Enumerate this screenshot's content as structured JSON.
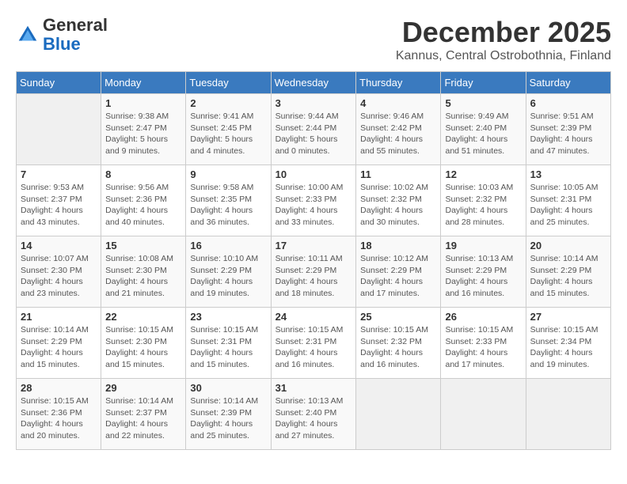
{
  "header": {
    "logo_line1": "General",
    "logo_line2": "Blue",
    "month": "December 2025",
    "location": "Kannus, Central Ostrobothnia, Finland"
  },
  "days_of_week": [
    "Sunday",
    "Monday",
    "Tuesday",
    "Wednesday",
    "Thursday",
    "Friday",
    "Saturday"
  ],
  "weeks": [
    [
      {
        "day": "",
        "info": ""
      },
      {
        "day": "1",
        "info": "Sunrise: 9:38 AM\nSunset: 2:47 PM\nDaylight: 5 hours\nand 9 minutes."
      },
      {
        "day": "2",
        "info": "Sunrise: 9:41 AM\nSunset: 2:45 PM\nDaylight: 5 hours\nand 4 minutes."
      },
      {
        "day": "3",
        "info": "Sunrise: 9:44 AM\nSunset: 2:44 PM\nDaylight: 5 hours\nand 0 minutes."
      },
      {
        "day": "4",
        "info": "Sunrise: 9:46 AM\nSunset: 2:42 PM\nDaylight: 4 hours\nand 55 minutes."
      },
      {
        "day": "5",
        "info": "Sunrise: 9:49 AM\nSunset: 2:40 PM\nDaylight: 4 hours\nand 51 minutes."
      },
      {
        "day": "6",
        "info": "Sunrise: 9:51 AM\nSunset: 2:39 PM\nDaylight: 4 hours\nand 47 minutes."
      }
    ],
    [
      {
        "day": "7",
        "info": "Sunrise: 9:53 AM\nSunset: 2:37 PM\nDaylight: 4 hours\nand 43 minutes."
      },
      {
        "day": "8",
        "info": "Sunrise: 9:56 AM\nSunset: 2:36 PM\nDaylight: 4 hours\nand 40 minutes."
      },
      {
        "day": "9",
        "info": "Sunrise: 9:58 AM\nSunset: 2:35 PM\nDaylight: 4 hours\nand 36 minutes."
      },
      {
        "day": "10",
        "info": "Sunrise: 10:00 AM\nSunset: 2:33 PM\nDaylight: 4 hours\nand 33 minutes."
      },
      {
        "day": "11",
        "info": "Sunrise: 10:02 AM\nSunset: 2:32 PM\nDaylight: 4 hours\nand 30 minutes."
      },
      {
        "day": "12",
        "info": "Sunrise: 10:03 AM\nSunset: 2:32 PM\nDaylight: 4 hours\nand 28 minutes."
      },
      {
        "day": "13",
        "info": "Sunrise: 10:05 AM\nSunset: 2:31 PM\nDaylight: 4 hours\nand 25 minutes."
      }
    ],
    [
      {
        "day": "14",
        "info": "Sunrise: 10:07 AM\nSunset: 2:30 PM\nDaylight: 4 hours\nand 23 minutes."
      },
      {
        "day": "15",
        "info": "Sunrise: 10:08 AM\nSunset: 2:30 PM\nDaylight: 4 hours\nand 21 minutes."
      },
      {
        "day": "16",
        "info": "Sunrise: 10:10 AM\nSunset: 2:29 PM\nDaylight: 4 hours\nand 19 minutes."
      },
      {
        "day": "17",
        "info": "Sunrise: 10:11 AM\nSunset: 2:29 PM\nDaylight: 4 hours\nand 18 minutes."
      },
      {
        "day": "18",
        "info": "Sunrise: 10:12 AM\nSunset: 2:29 PM\nDaylight: 4 hours\nand 17 minutes."
      },
      {
        "day": "19",
        "info": "Sunrise: 10:13 AM\nSunset: 2:29 PM\nDaylight: 4 hours\nand 16 minutes."
      },
      {
        "day": "20",
        "info": "Sunrise: 10:14 AM\nSunset: 2:29 PM\nDaylight: 4 hours\nand 15 minutes."
      }
    ],
    [
      {
        "day": "21",
        "info": "Sunrise: 10:14 AM\nSunset: 2:29 PM\nDaylight: 4 hours\nand 15 minutes."
      },
      {
        "day": "22",
        "info": "Sunrise: 10:15 AM\nSunset: 2:30 PM\nDaylight: 4 hours\nand 15 minutes."
      },
      {
        "day": "23",
        "info": "Sunrise: 10:15 AM\nSunset: 2:31 PM\nDaylight: 4 hours\nand 15 minutes."
      },
      {
        "day": "24",
        "info": "Sunrise: 10:15 AM\nSunset: 2:31 PM\nDaylight: 4 hours\nand 16 minutes."
      },
      {
        "day": "25",
        "info": "Sunrise: 10:15 AM\nSunset: 2:32 PM\nDaylight: 4 hours\nand 16 minutes."
      },
      {
        "day": "26",
        "info": "Sunrise: 10:15 AM\nSunset: 2:33 PM\nDaylight: 4 hours\nand 17 minutes."
      },
      {
        "day": "27",
        "info": "Sunrise: 10:15 AM\nSunset: 2:34 PM\nDaylight: 4 hours\nand 19 minutes."
      }
    ],
    [
      {
        "day": "28",
        "info": "Sunrise: 10:15 AM\nSunset: 2:36 PM\nDaylight: 4 hours\nand 20 minutes."
      },
      {
        "day": "29",
        "info": "Sunrise: 10:14 AM\nSunset: 2:37 PM\nDaylight: 4 hours\nand 22 minutes."
      },
      {
        "day": "30",
        "info": "Sunrise: 10:14 AM\nSunset: 2:39 PM\nDaylight: 4 hours\nand 25 minutes."
      },
      {
        "day": "31",
        "info": "Sunrise: 10:13 AM\nSunset: 2:40 PM\nDaylight: 4 hours\nand 27 minutes."
      },
      {
        "day": "",
        "info": ""
      },
      {
        "day": "",
        "info": ""
      },
      {
        "day": "",
        "info": ""
      }
    ]
  ]
}
